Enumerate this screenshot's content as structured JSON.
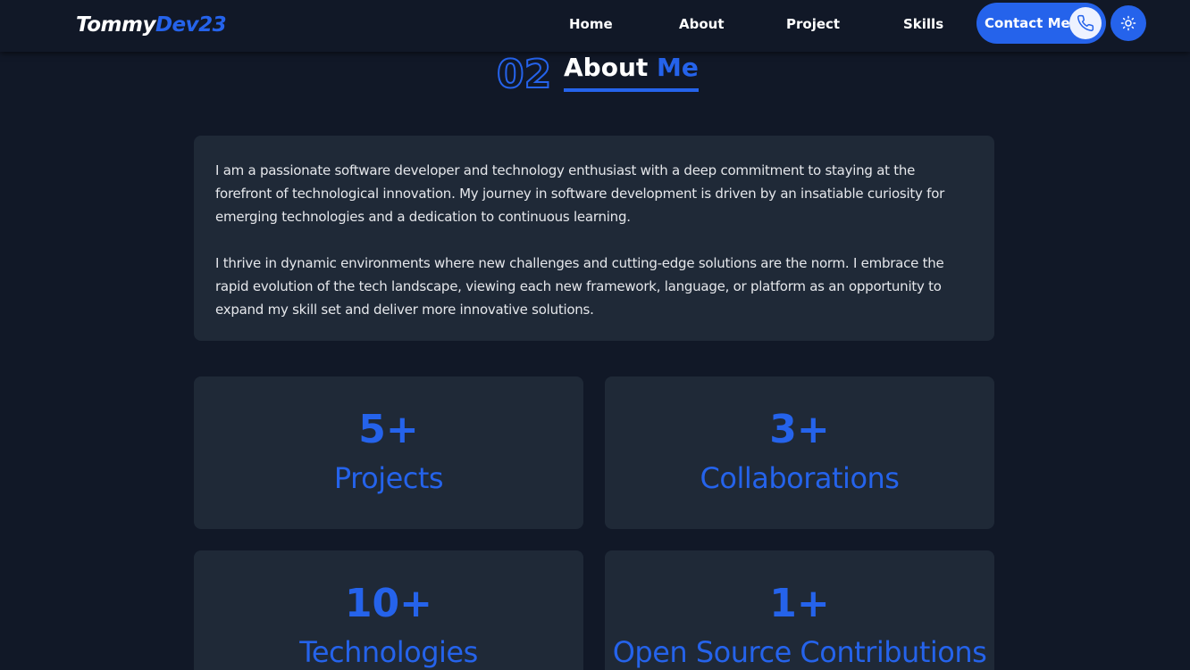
{
  "nav": {
    "logo_part1": "Tommy",
    "logo_part2": "Dev23",
    "links": [
      "Home",
      "About",
      "Project",
      "Skills"
    ],
    "contact_label": "Contact Me",
    "contact_icon": "phone-icon",
    "theme_icon": "sun-icon"
  },
  "section": {
    "number": "02",
    "title_part1": "About",
    "title_part2": "Me"
  },
  "about": {
    "paragraphs": [
      "I am a passionate software developer and technology enthusiast with a deep commitment to staying at the forefront of technological innovation. My journey in software development is driven by an insatiable curiosity for emerging technologies and a dedication to continuous learning.",
      "I thrive in dynamic environments where new challenges and cutting-edge solutions are the norm. I embrace the rapid evolution of the tech landscape, viewing each new framework, language, or platform as an opportunity to expand my skill set and deliver more innovative solutions."
    ]
  },
  "stats": [
    {
      "value": "5+",
      "label": "Projects"
    },
    {
      "value": "3+",
      "label": "Collaborations"
    },
    {
      "value": "10+",
      "label": "Technologies"
    },
    {
      "value": "1+",
      "label": "Open Source Contributions"
    }
  ],
  "colors": {
    "background": "#111827",
    "card": "#1f2937",
    "accent": "#2563eb",
    "text": "#e5e7eb"
  }
}
